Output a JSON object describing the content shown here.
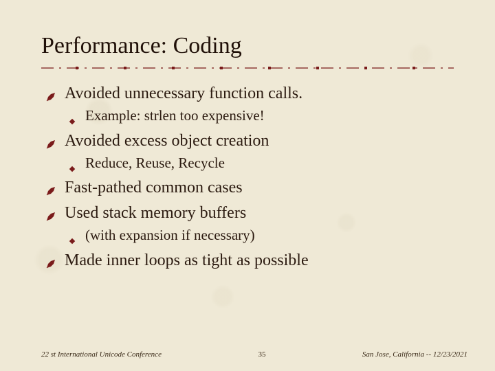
{
  "title": "Performance: Coding",
  "bullets": [
    {
      "text": "Avoided unnecessary function calls.",
      "sub": [
        {
          "text": "Example: strlen too expensive!"
        }
      ]
    },
    {
      "text": "Avoided excess object creation",
      "sub": [
        {
          "text": "Reduce, Reuse, Recycle"
        }
      ]
    },
    {
      "text": "Fast-pathed common cases"
    },
    {
      "text": "Used stack memory buffers",
      "sub": [
        {
          "text": "(with expansion if necessary)"
        }
      ]
    },
    {
      "text": "Made inner loops as tight as possible"
    }
  ],
  "footer": {
    "left": "22 st International Unicode Conference",
    "center": "35",
    "right": "San Jose, California -- 12/23/2021"
  },
  "colors": {
    "accent": "#7a1b1b"
  }
}
